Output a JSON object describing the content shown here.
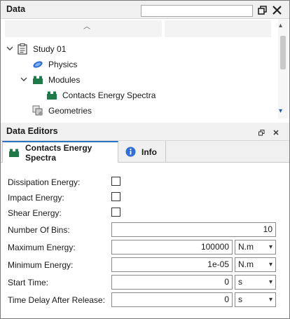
{
  "data_panel": {
    "title": "Data",
    "search": {
      "value": "",
      "placeholder": ""
    },
    "tree": [
      {
        "label": "Study 01",
        "icon": "clipboard-icon",
        "expander": "expanded"
      },
      {
        "label": "Physics",
        "icon": "physics-icon"
      },
      {
        "label": "Modules",
        "icon": "modules-icon",
        "expander": "expanded"
      },
      {
        "label": "Contacts Energy Spectra",
        "icon": "module-block-icon"
      },
      {
        "label": "Geometries",
        "icon": "geometries-icon"
      }
    ]
  },
  "editors_panel": {
    "title": "Data Editors",
    "tabs": [
      {
        "label": "Contacts Energy Spectra",
        "active": true
      },
      {
        "label": "Info",
        "active": false
      }
    ],
    "fields": {
      "dissipation_energy": {
        "label": "Dissipation Energy:",
        "checked": false
      },
      "impact_energy": {
        "label": "Impact Energy:",
        "checked": false
      },
      "shear_energy": {
        "label": "Shear Energy:",
        "checked": false
      },
      "number_of_bins": {
        "label": "Number Of Bins:",
        "value": "10"
      },
      "maximum_energy": {
        "label": "Maximum Energy:",
        "value": "100000",
        "unit": "N.m"
      },
      "minimum_energy": {
        "label": "Minimum Energy:",
        "value": "1e-05",
        "unit": "N.m"
      },
      "start_time": {
        "label": "Start Time:",
        "value": "0",
        "unit": "s"
      },
      "time_delay": {
        "label": "Time Delay After Release:",
        "value": "0",
        "unit": "s"
      }
    }
  },
  "colors": {
    "accent": "#2a72c8",
    "module_green": "#1f7a4a",
    "physics_blue": "#2f6fd6"
  }
}
